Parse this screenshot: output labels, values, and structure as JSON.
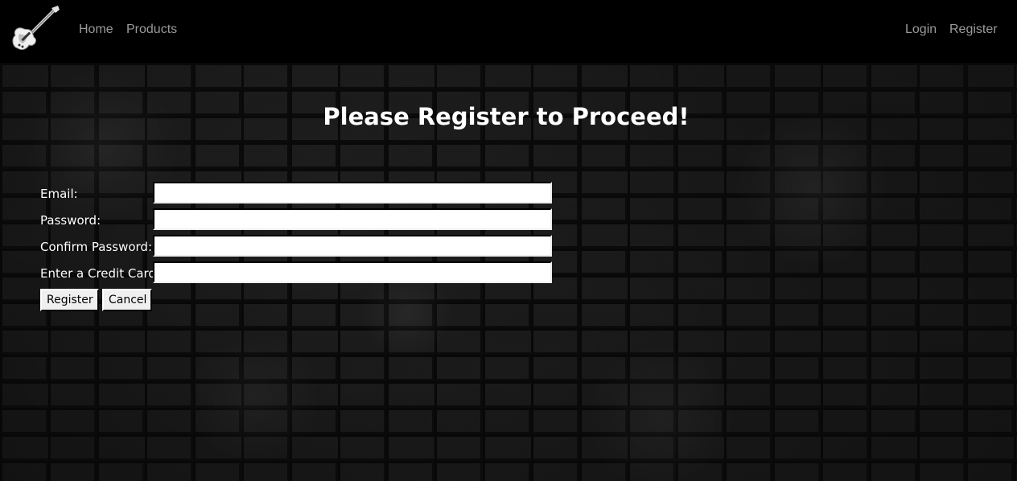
{
  "nav": {
    "logo_icon": "electric-guitar-icon",
    "links_left": [
      {
        "label": "Home"
      },
      {
        "label": "Products"
      }
    ],
    "links_right": [
      {
        "label": "Login"
      },
      {
        "label": "Register"
      }
    ]
  },
  "main": {
    "title": "Please Register to Proceed!",
    "form": {
      "fields": [
        {
          "label": "Email:",
          "value": "",
          "placeholder": ""
        },
        {
          "label": "Password:",
          "value": "",
          "placeholder": ""
        },
        {
          "label": "Confirm Password:",
          "value": "",
          "placeholder": ""
        },
        {
          "label": "Enter a Credit Card:",
          "value": "",
          "placeholder": ""
        }
      ],
      "submit_label": "Register",
      "cancel_label": "Cancel"
    }
  },
  "colors": {
    "navbar_bg": "#000000",
    "nav_link": "#9a9a9a",
    "title_text": "#ffffff",
    "label_text": "#ffffff",
    "wall_bg": "#1a1a1a"
  }
}
